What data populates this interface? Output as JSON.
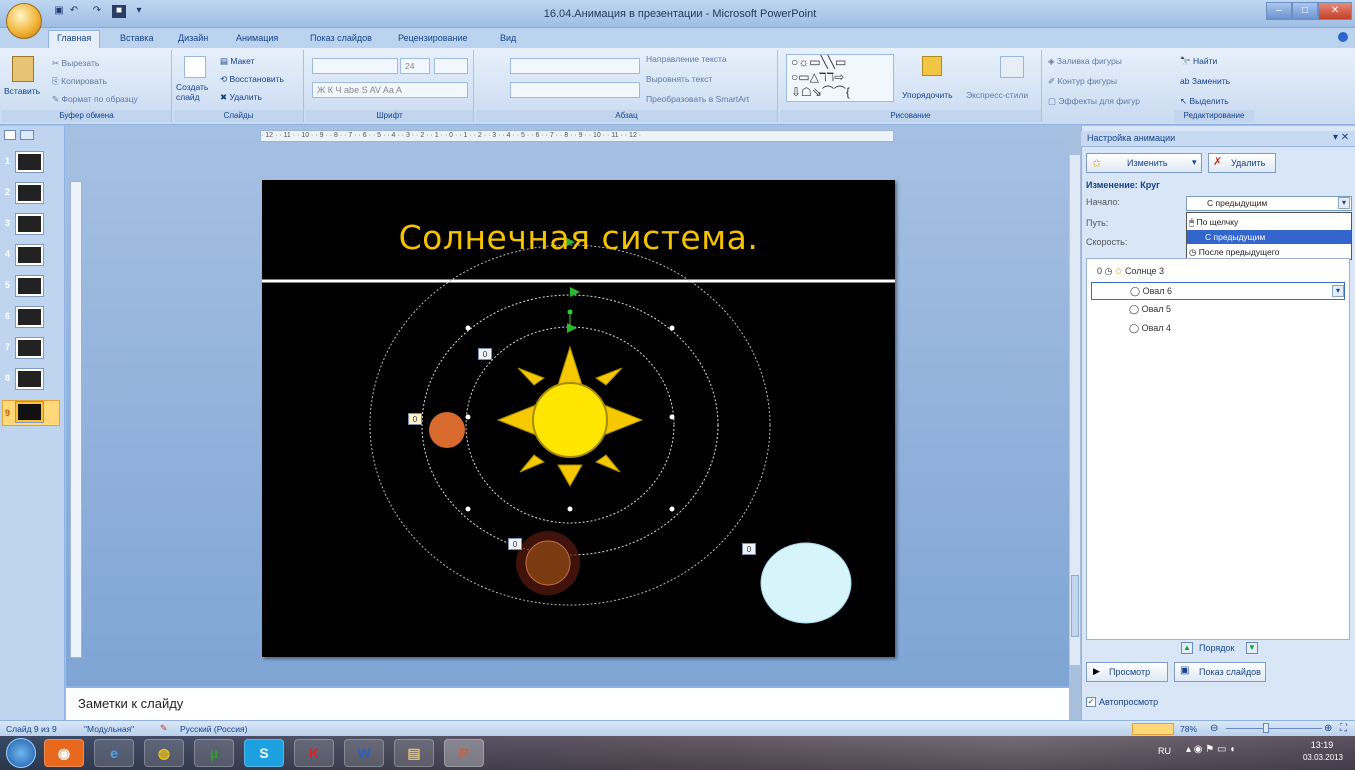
{
  "window": {
    "title": "16.04.Анимация в презентации - Microsoft PowerPoint",
    "controls": [
      "–",
      "□",
      "✕"
    ]
  },
  "tabs": [
    "Главная",
    "Вставка",
    "Дизайн",
    "Анимация",
    "Показ слайдов",
    "Рецензирование",
    "Вид"
  ],
  "active_tab": "Главная",
  "ribbon": {
    "clipboard": {
      "label": "Буфер обмена",
      "paste": "Вставить",
      "cut": "Вырезать",
      "copy": "Копировать",
      "format": "Формат по образцу"
    },
    "slides": {
      "label": "Слайды",
      "new": "Создать слайд",
      "layout": "Макет",
      "reset": "Восстановить",
      "delete": "Удалить"
    },
    "font": {
      "label": "Шрифт",
      "size": "24"
    },
    "paragraph": {
      "label": "Абзац",
      "direction": "Направление текста",
      "align": "Выровнять текст",
      "smartart": "Преобразовать в SmartArt"
    },
    "drawing": {
      "label": "Рисование",
      "arrange": "Упорядочить",
      "styles": "Экспресс-стили",
      "fill": "Заливка фигуры",
      "outline": "Контур фигуры",
      "effects": "Эффекты для фигур"
    },
    "editing": {
      "label": "Редактирование",
      "find": "Найти",
      "replace": "Заменить",
      "select": "Выделить"
    }
  },
  "slide_numbers": [
    "1",
    "2",
    "3",
    "4",
    "5",
    "6",
    "7",
    "8",
    "9"
  ],
  "ruler": {
    "horizontal": "· 12 · · 11 · · 10 · · 9 · · 8 · · 7 · · 6 · · 5 · · 4 · · 3 · · 2 · · 1 · · 0 · · 1 · · 2 · · 3 · · 4 · · 5 · · 6 · · 7 · · 8 · · 9 · · 10 · · 11 · · 12 ·"
  },
  "slide": {
    "title": "Солнечная система.",
    "tags": [
      "0",
      "0",
      "0",
      "0"
    ]
  },
  "notes": {
    "placeholder": "Заметки к слайду"
  },
  "pane": {
    "title": "Настройка анимации",
    "change_button": "Изменить",
    "delete_button": "Удалить",
    "section": "Изменение: Круг",
    "start_label": "Начало:",
    "start_value": "С предыдущим",
    "path_label": "Путь:",
    "speed_label": "Скорость:",
    "dropdown_options": [
      "По щелчку",
      "С предыдущим",
      "После предыдущего"
    ],
    "selected_option": "С предыдущим",
    "items": [
      {
        "num": "0",
        "name": "Солнце 3"
      },
      {
        "num": "",
        "name": "Овал 6"
      },
      {
        "num": "",
        "name": "Овал 5"
      },
      {
        "num": "",
        "name": "Овал 4"
      }
    ],
    "order_label": "Порядок",
    "preview_button": "Просмотр",
    "slideshow_button": "Показ слайдов",
    "autopreview": "Автопросмотр"
  },
  "status": {
    "slide": "Слайд 9 из 9",
    "theme": "\"Модульная\"",
    "language": "Русский (Россия)",
    "zoom": "78%"
  },
  "taskbar": {
    "lang": "RU",
    "time": "13:19",
    "date": "03.03.2013"
  },
  "colors": {
    "title_yellow": "#f5c200",
    "sun": "#ffe600",
    "planet_orange": "#d96a2e",
    "planet_brown": "#7a3b10",
    "planet_ice": "#d8f4fb",
    "highlight": "#3366cc"
  }
}
